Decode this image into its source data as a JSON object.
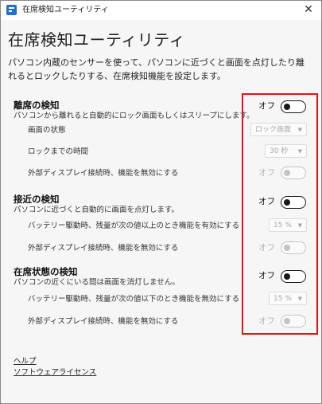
{
  "window": {
    "title": "在席検知ユーティリティ",
    "close_glyph": "✕"
  },
  "page": {
    "title": "在席検知ユーティリティ",
    "description": "パソコン内蔵のセンサーを使って、パソコンに近づくと画面を点灯したり離れるとロックしたりする、在席検知機能を設定します。"
  },
  "sections": {
    "leave": {
      "title": "離席の検知",
      "subtitle": "パソコンから離れると自動的にロック画面もしくはスリープにします。",
      "toggle_state": "オフ",
      "screen_state_label": "画面の状態",
      "screen_state_value": "ロック画面",
      "lock_time_label": "ロックまでの時間",
      "lock_time_value": "30 秒",
      "external_display_label": "外部ディスプレイ接続時、機能を無効にする",
      "external_display_state": "オフ"
    },
    "approach": {
      "title": "接近の検知",
      "subtitle": "パソコンに近づくと自動的に画面を点灯します。",
      "toggle_state": "オフ",
      "battery_label": "バッテリー駆動時、残量が次の値以上のとき機能を有効にする",
      "battery_value": "15 %",
      "external_display_label": "外部ディスプレイ接続時、機能を無効にする",
      "external_display_state": "オフ"
    },
    "presence": {
      "title": "在席状態の検知",
      "subtitle": "パソコンの近くにいる間は画面を消灯しません。",
      "toggle_state": "オフ",
      "battery_label": "バッテリー駆動時、残量が次の値以下のとき機能を無効にする",
      "battery_value": "15 %",
      "external_display_label": "外部ディスプレイ接続時、機能を無効にする",
      "external_display_state": "オフ"
    }
  },
  "footer": {
    "help": "ヘルプ",
    "license": "ソフトウェアライセンス"
  },
  "colors": {
    "highlight": "#e0131b",
    "accent": "#1e6fd0"
  },
  "icons": {
    "app": "app-icon",
    "close": "close-icon",
    "dropdown": "chevron-down-icon"
  }
}
